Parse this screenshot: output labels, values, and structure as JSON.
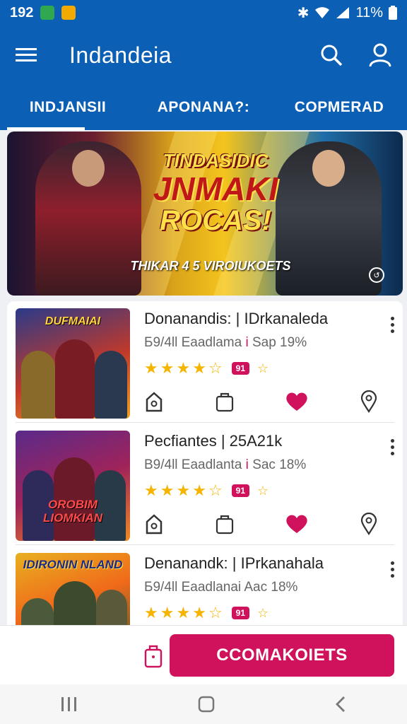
{
  "status": {
    "time": "192",
    "indicators": "11%",
    "battery_icon": "battery-icon"
  },
  "appbar": {
    "title": "Indandeia",
    "menu_icon": "menu-icon",
    "search_icon": "search-icon",
    "profile_icon": "person-icon"
  },
  "tabs": [
    {
      "label": "INDJANSII",
      "active": true
    },
    {
      "label": "APONANA?:",
      "active": false
    },
    {
      "label": "COPMERAD",
      "active": false
    }
  ],
  "banner": {
    "line1": "TINDASIDIC",
    "line2": "JNMAKI",
    "line3": "ROCAS!",
    "caption": "THIKAR 4 5 VIROIUKOETS"
  },
  "items": [
    {
      "title": "Donanandis: | IDrkanaleda",
      "sub_a": "Б9/4ll Eaadlama",
      "sub_sep": "i",
      "sub_b": "Sap 19%",
      "badge": "91",
      "thumb_text": "DUFMAIAI"
    },
    {
      "title": "Pecfiantes | 25A21k",
      "sub_a": "B9/4ll Eaadlanta",
      "sub_sep": "i",
      "sub_b": "Sac 18%",
      "badge": "91",
      "thumb_text": "OROBIM LIOMKIAN"
    },
    {
      "title": "Denanandk: | IPrkanahala",
      "sub_a": "Б9/4ll Eaadlanai",
      "sub_sep": "",
      "sub_b": "Aac 18%",
      "badge": "91",
      "thumb_text": "IDIRONIN NLAND"
    }
  ],
  "item_actions": [
    "home-icon",
    "bag-icon",
    "heart-icon",
    "location-pin-icon"
  ],
  "cta": {
    "label": "CCOMAKOIETS"
  },
  "colors": {
    "primary": "#0b5fb4",
    "accent": "#d0115c",
    "star": "#f4b400"
  }
}
